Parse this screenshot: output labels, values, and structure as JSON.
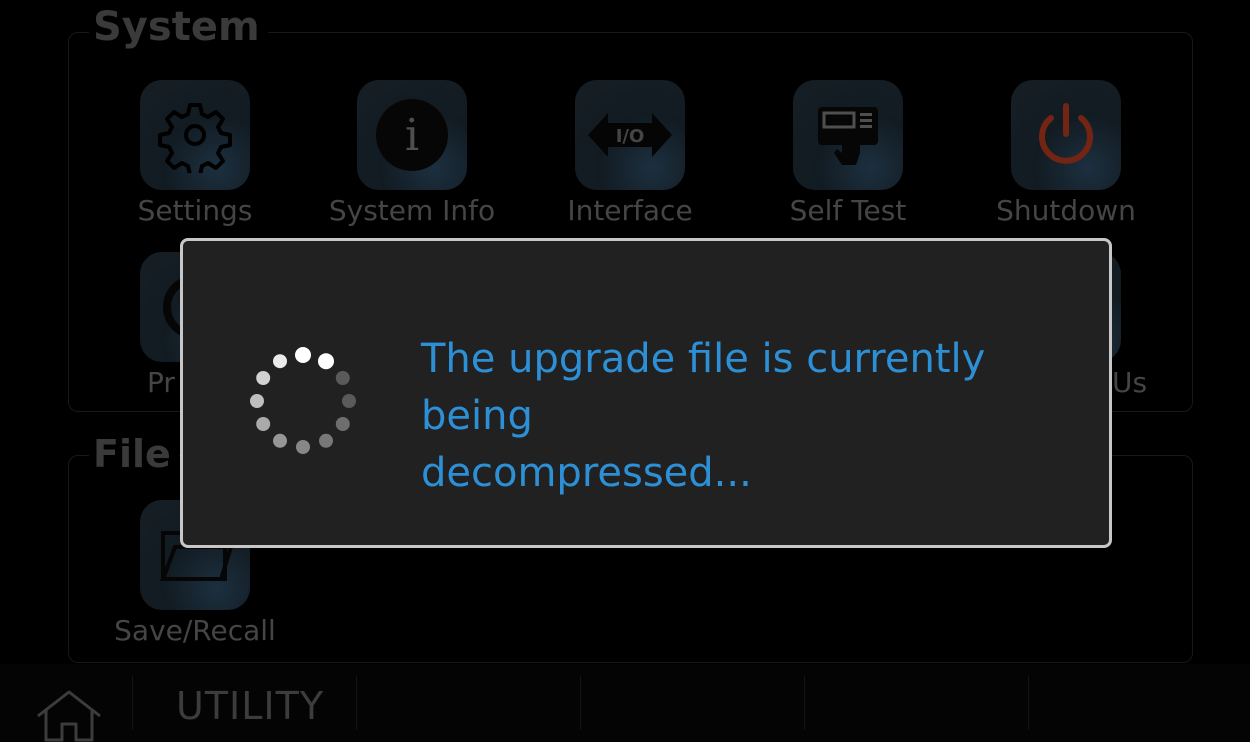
{
  "groups": {
    "system_title": "System",
    "file_title": "File"
  },
  "system_items": [
    {
      "label": "Settings",
      "icon": "gear-icon"
    },
    {
      "label": "System Info",
      "icon": "info-icon"
    },
    {
      "label": "Interface",
      "icon": "io-icon"
    },
    {
      "label": "Self Test",
      "icon": "self-test-icon"
    },
    {
      "label": "Shutdown",
      "icon": "power-icon"
    }
  ],
  "system_row2_partial": {
    "left_label": "Pr",
    "right_label": "Us"
  },
  "file_items": [
    {
      "label": "Save/Recall",
      "icon": "folder-icon"
    }
  ],
  "navbar": {
    "home_icon": "home-icon",
    "title": "UTILITY"
  },
  "dialog": {
    "message": "The upgrade file is currently being\ndecompressed...",
    "spinner_icon": "loading-spinner-icon"
  },
  "colors": {
    "message": "#2d8fd5",
    "dialog_bg": "#212121",
    "dialog_border": "#c7c7c7",
    "power_icon": "#b3381c"
  }
}
